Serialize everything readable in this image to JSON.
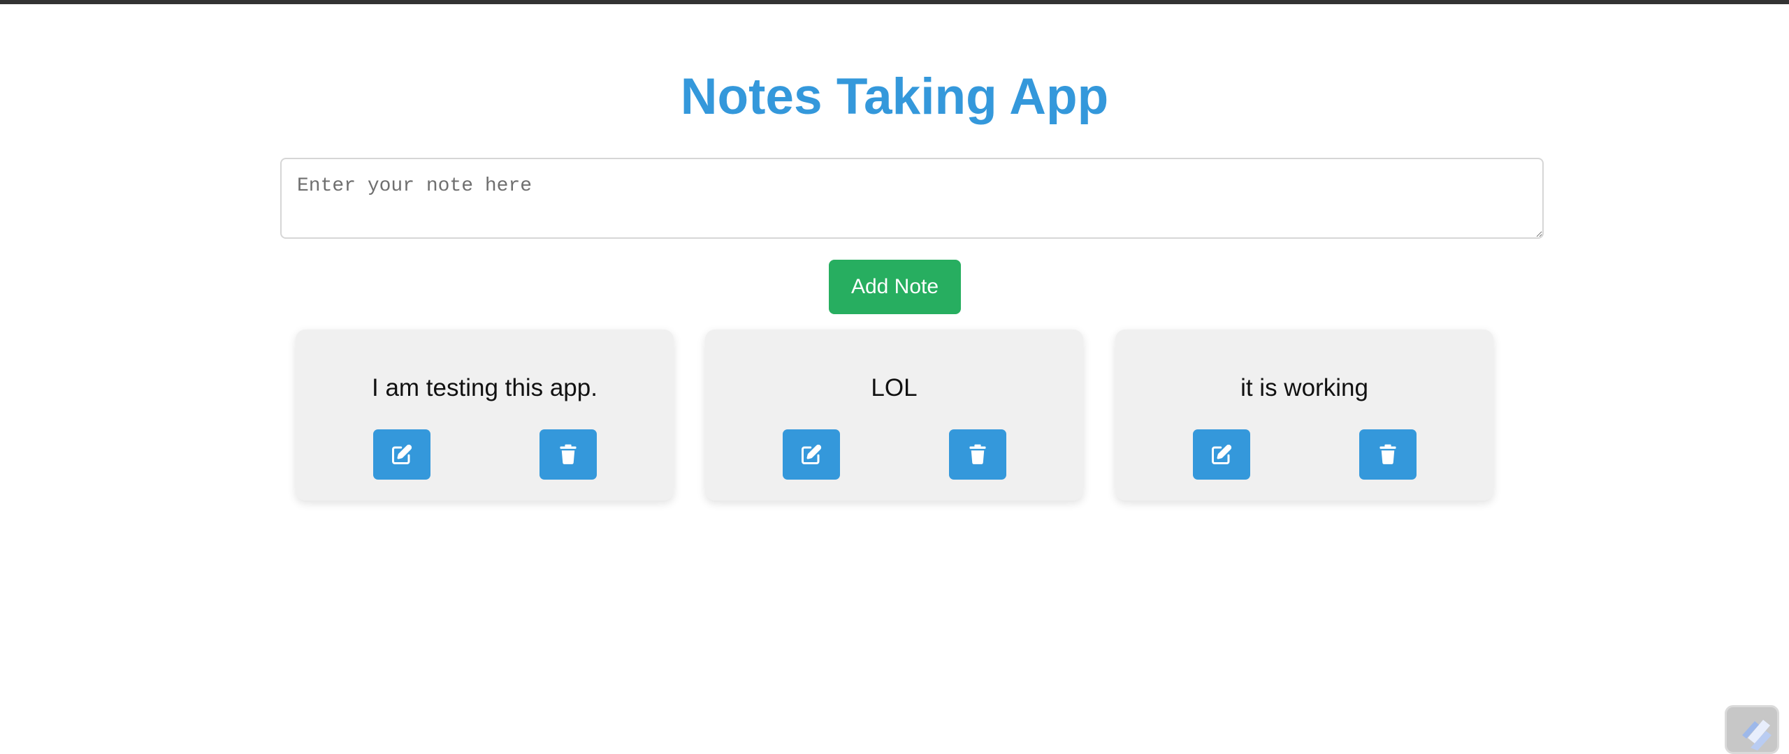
{
  "app": {
    "title": "Notes Taking App"
  },
  "input": {
    "placeholder": "Enter your note here",
    "value": ""
  },
  "add_button": {
    "label": "Add Note",
    "color": "#27ae60"
  },
  "notes": [
    {
      "text": "I am testing this app.",
      "edit_icon": "edit-icon",
      "delete_icon": "trash-icon"
    },
    {
      "text": "LOL",
      "edit_icon": "edit-icon",
      "delete_icon": "trash-icon"
    },
    {
      "text": "it is working",
      "edit_icon": "edit-icon",
      "delete_icon": "trash-icon"
    }
  ],
  "colors": {
    "accent": "#3498db",
    "success": "#27ae60",
    "card_background": "#f0f0f0"
  },
  "corner_widget": {
    "icon": "extension-icon"
  }
}
